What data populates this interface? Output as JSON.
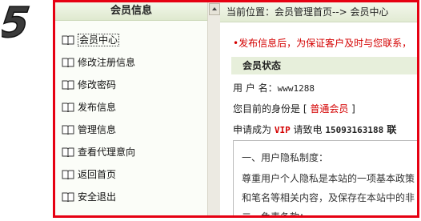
{
  "step_number": "5",
  "sidebar": {
    "title": "会员信息",
    "items": [
      {
        "label": "会员中心",
        "icon": "book-icon"
      },
      {
        "label": "修改注册信息",
        "icon": "book-icon"
      },
      {
        "label": "修改密码",
        "icon": "book-icon"
      },
      {
        "label": "发布信息",
        "icon": "book-icon"
      },
      {
        "label": "管理信息",
        "icon": "book-icon"
      },
      {
        "label": "查看代理意向",
        "icon": "book-icon"
      },
      {
        "label": "返回首页",
        "icon": "book-icon"
      },
      {
        "label": "安全退出",
        "icon": "book-icon"
      }
    ]
  },
  "breadcrumb": "当前位置：会员管理首页--> 会员中心",
  "notice": "•发布信息后，为保证客户及时与您联系，",
  "status": {
    "title": "会员状态",
    "username_label": "用 户 名：",
    "username": "www1288",
    "identity_prefix": "您目前的身份是 [ ",
    "identity_value": "普通会员",
    "identity_suffix": " ]",
    "apply_prefix": "申请成为 ",
    "apply_vip": "VIP",
    "apply_middle": " 请致电 ",
    "apply_phone": "15093163188",
    "apply_suffix": " 联"
  },
  "terms": {
    "line1": "一、用户隐私制度：",
    "line2": "尊重用户个人隐私是本站的一项基本政策",
    "line3": "和笔名等相关内容，及保存在本站中的非",
    "line4": "二、免责条款："
  },
  "colors": {
    "frame": "#e60012",
    "accent_red": "#d40000",
    "header_green": "#e2ebd3"
  }
}
